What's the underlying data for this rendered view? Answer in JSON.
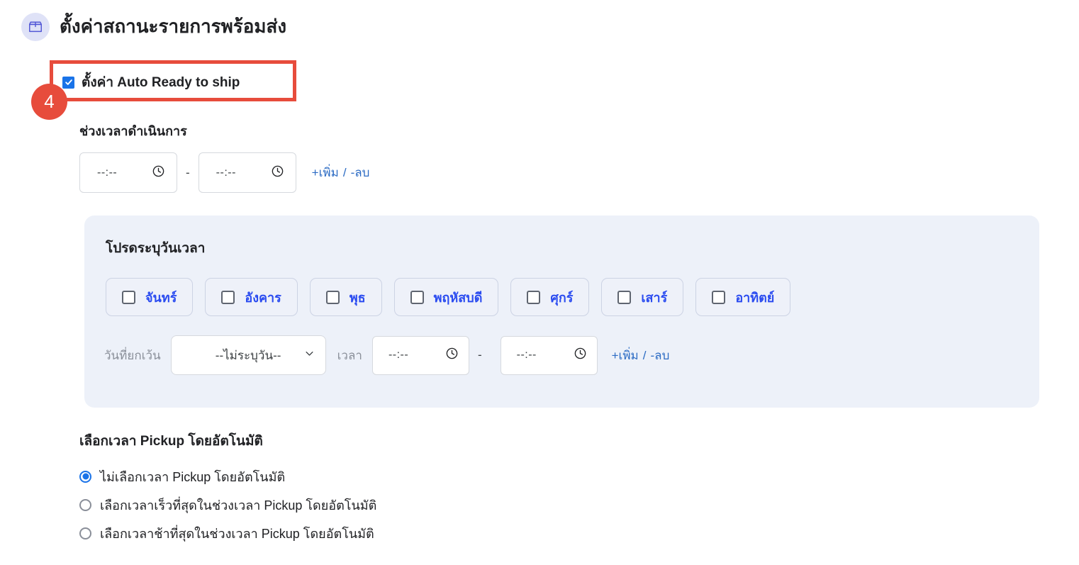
{
  "header": {
    "icon": "package-box-icon",
    "title": "ตั้งค่าสถานะรายการพร้อมส่ง",
    "icon_circle_color": "#dfe2f7",
    "icon_stroke_color": "#5257d6"
  },
  "annotation": {
    "badge_number": "4",
    "color": "#e74c3c"
  },
  "auto_ready": {
    "label": "ตั้งค่า Auto Ready to ship",
    "checked": true,
    "checkbox_color": "#1a73e8"
  },
  "operating_hours": {
    "label": "ช่วงเวลาดำเนินการ",
    "start_time_placeholder": "--:--",
    "end_time_placeholder": "--:--",
    "separator": "-",
    "add_link": "+เพิ่ม",
    "link_separator": "/",
    "remove_link": "-ลบ",
    "link_color": "#2d6cc4"
  },
  "schedule_panel": {
    "title": "โปรดระบุวันเวลา",
    "background_color": "#edf1f9",
    "days": [
      {
        "label": "จันทร์",
        "checked": false
      },
      {
        "label": "อังคาร",
        "checked": false
      },
      {
        "label": "พุธ",
        "checked": false
      },
      {
        "label": "พฤหัสบดี",
        "checked": false
      },
      {
        "label": "ศุกร์",
        "checked": false
      },
      {
        "label": "เสาร์",
        "checked": false
      },
      {
        "label": "อาทิตย์",
        "checked": false
      }
    ],
    "day_label_color": "#2b4cf0",
    "exception": {
      "label": "วันที่ยกเว้น",
      "select_value": "--ไม่ระบุวัน--",
      "time_label": "เวลา",
      "start_time_placeholder": "--:--",
      "end_time_placeholder": "--:--",
      "separator": "-",
      "add_link": "+เพิ่ม",
      "link_separator": "/",
      "remove_link": "-ลบ"
    }
  },
  "pickup": {
    "label": "เลือกเวลา Pickup โดยอัตโนมัติ",
    "selected_index": 0,
    "options": [
      {
        "label": "ไม่เลือกเวลา Pickup โดยอัตโนมัติ"
      },
      {
        "label": "เลือกเวลาเร็วที่สุดในช่วงเวลา Pickup โดยอัตโนมัติ"
      },
      {
        "label": "เลือกเวลาช้าที่สุดในช่วงเวลา Pickup โดยอัตโนมัติ"
      }
    ],
    "radio_color": "#1a73e8"
  }
}
